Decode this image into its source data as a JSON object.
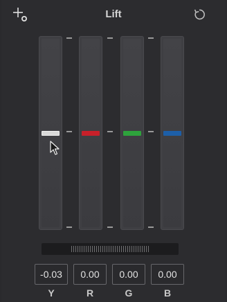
{
  "header": {
    "title": "Lift",
    "picker_icon": "color-picker-crosshair-icon",
    "reset_icon": "reset-icon"
  },
  "channels": [
    {
      "label": "Y",
      "value": "-0.03",
      "color": "#d9d9d9",
      "level": 0.5
    },
    {
      "label": "R",
      "value": "0.00",
      "color": "#c8202a",
      "level": 0.5
    },
    {
      "label": "G",
      "value": "0.00",
      "color": "#2ea33c",
      "level": 0.5
    },
    {
      "label": "B",
      "value": "0.00",
      "color": "#1d5fa8",
      "level": 0.5
    }
  ],
  "jog_wheel": {
    "icon": "jog-wheel-icon"
  },
  "pointer": {
    "icon": "mouse-pointer-icon"
  }
}
